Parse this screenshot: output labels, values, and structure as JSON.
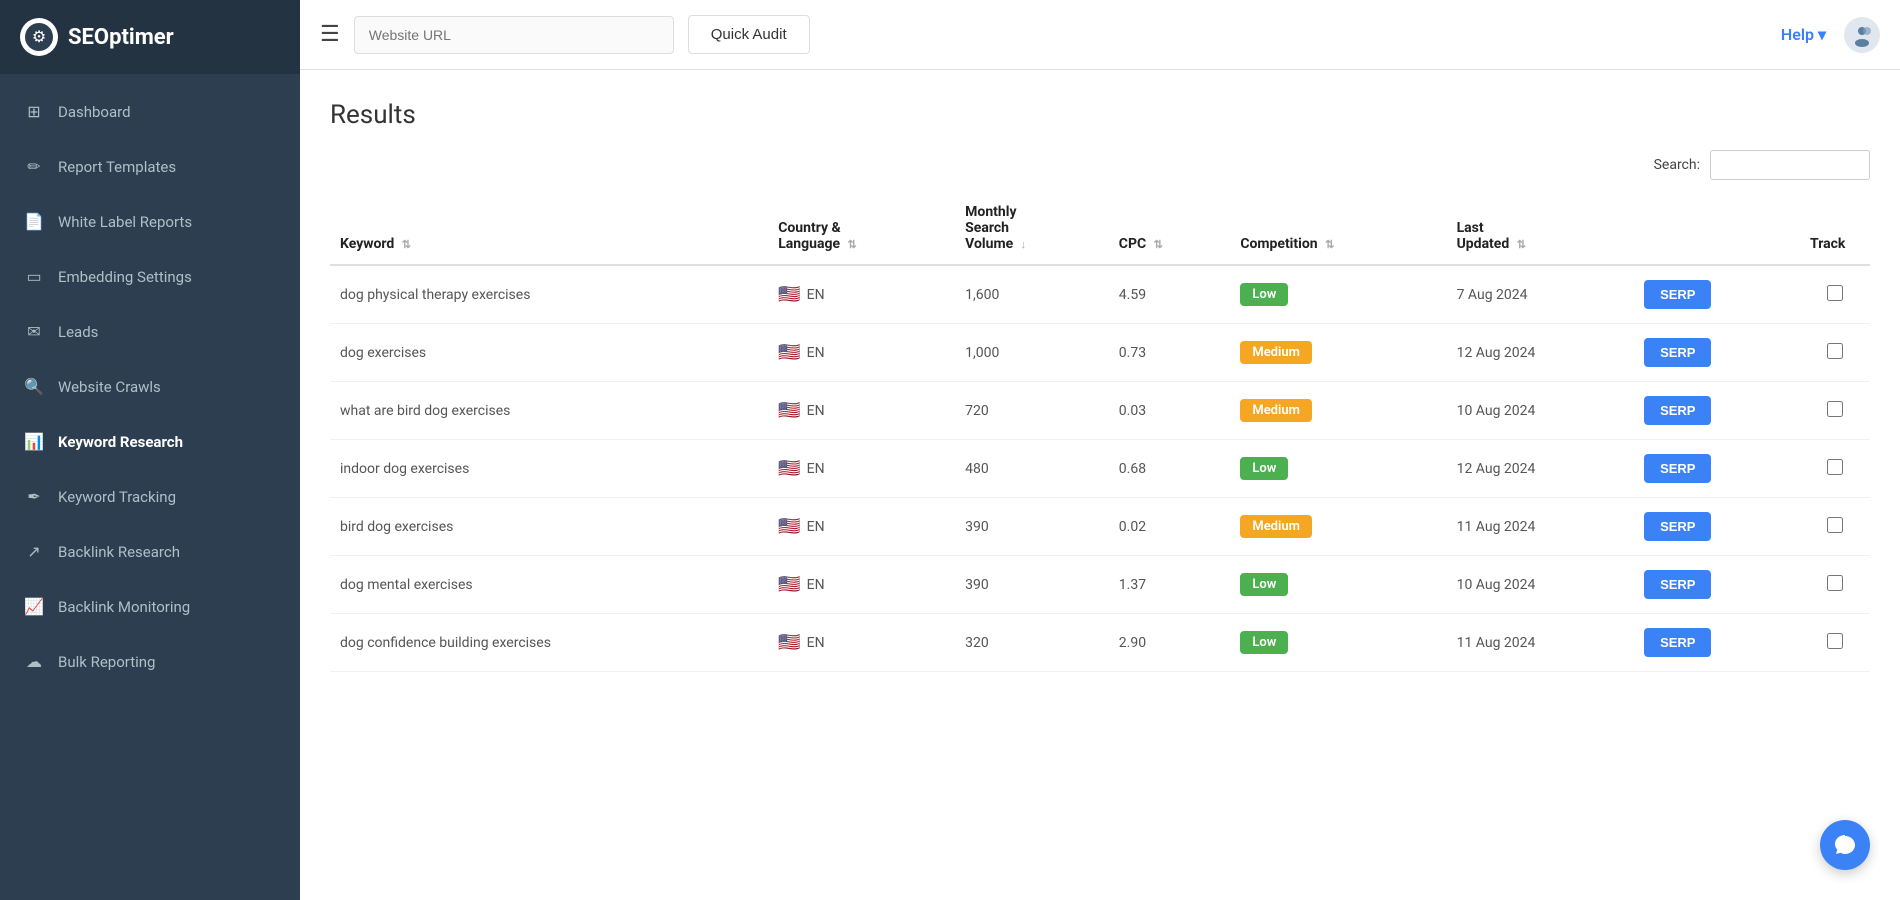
{
  "app": {
    "name": "SEOptimer",
    "logo_symbol": "⚙"
  },
  "sidebar": {
    "items": [
      {
        "id": "dashboard",
        "label": "Dashboard",
        "icon": "⊞",
        "active": false
      },
      {
        "id": "report-templates",
        "label": "Report Templates",
        "icon": "✏",
        "active": false
      },
      {
        "id": "white-label-reports",
        "label": "White Label Reports",
        "icon": "📄",
        "active": false
      },
      {
        "id": "embedding-settings",
        "label": "Embedding Settings",
        "icon": "▭",
        "active": false
      },
      {
        "id": "leads",
        "label": "Leads",
        "icon": "✉",
        "active": false
      },
      {
        "id": "website-crawls",
        "label": "Website Crawls",
        "icon": "🔍",
        "active": false
      },
      {
        "id": "keyword-research",
        "label": "Keyword Research",
        "icon": "📊",
        "active": true
      },
      {
        "id": "keyword-tracking",
        "label": "Keyword Tracking",
        "icon": "✒",
        "active": false
      },
      {
        "id": "backlink-research",
        "label": "Backlink Research",
        "icon": "↗",
        "active": false
      },
      {
        "id": "backlink-monitoring",
        "label": "Backlink Monitoring",
        "icon": "📈",
        "active": false
      },
      {
        "id": "bulk-reporting",
        "label": "Bulk Reporting",
        "icon": "☁",
        "active": false
      }
    ]
  },
  "topbar": {
    "menu_icon": "☰",
    "url_placeholder": "Website URL",
    "quick_audit_label": "Quick Audit",
    "help_label": "Help",
    "help_arrow": "▾"
  },
  "content": {
    "results_title": "Results",
    "search_label": "Search:",
    "search_placeholder": "",
    "table": {
      "columns": [
        {
          "id": "keyword",
          "label": "Keyword",
          "sortable": true
        },
        {
          "id": "country-language",
          "label": "Country &\nLanguage",
          "sortable": true
        },
        {
          "id": "monthly-search",
          "label": "Monthly\nSearch\nVolume",
          "sortable": true
        },
        {
          "id": "cpc",
          "label": "CPC",
          "sortable": true
        },
        {
          "id": "competition",
          "label": "Competition",
          "sortable": true
        },
        {
          "id": "last-updated",
          "label": "Last\nUpdated",
          "sortable": true
        },
        {
          "id": "serp",
          "label": "",
          "sortable": false
        },
        {
          "id": "track",
          "label": "Track",
          "sortable": false
        }
      ],
      "rows": [
        {
          "keyword": "dog physical therapy exercises",
          "country": "EN",
          "monthly_volume": "1,600",
          "cpc": "4.59",
          "competition": "Low",
          "competition_level": "low",
          "last_updated": "7 Aug 2024"
        },
        {
          "keyword": "dog exercises",
          "country": "EN",
          "monthly_volume": "1,000",
          "cpc": "0.73",
          "competition": "Medium",
          "competition_level": "medium",
          "last_updated": "12 Aug 2024"
        },
        {
          "keyword": "what are bird dog exercises",
          "country": "EN",
          "monthly_volume": "720",
          "cpc": "0.03",
          "competition": "Medium",
          "competition_level": "medium",
          "last_updated": "10 Aug 2024"
        },
        {
          "keyword": "indoor dog exercises",
          "country": "EN",
          "monthly_volume": "480",
          "cpc": "0.68",
          "competition": "Low",
          "competition_level": "low",
          "last_updated": "12 Aug 2024"
        },
        {
          "keyword": "bird dog exercises",
          "country": "EN",
          "monthly_volume": "390",
          "cpc": "0.02",
          "competition": "Medium",
          "competition_level": "medium",
          "last_updated": "11 Aug 2024"
        },
        {
          "keyword": "dog mental exercises",
          "country": "EN",
          "monthly_volume": "390",
          "cpc": "1.37",
          "competition": "Low",
          "competition_level": "low",
          "last_updated": "10 Aug 2024"
        },
        {
          "keyword": "dog confidence building exercises",
          "country": "EN",
          "monthly_volume": "320",
          "cpc": "2.90",
          "competition": "Low",
          "competition_level": "low",
          "last_updated": "11 Aug 2024"
        }
      ],
      "serp_button_label": "SERP"
    }
  }
}
